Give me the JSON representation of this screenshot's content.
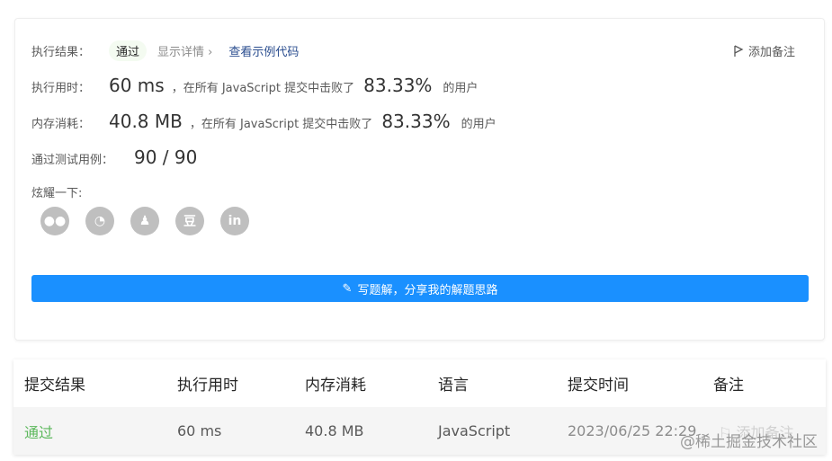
{
  "result": {
    "label": "执行结果：",
    "status": "通过",
    "detail": "显示详情 ›",
    "example": "查看示例代码",
    "add_note": "添加备注"
  },
  "runtime": {
    "label": "执行用时：",
    "value": "60 ms",
    "text": "，在所有 JavaScript 提交中击败了",
    "percent": "83.33%",
    "suffix": "的用户"
  },
  "memory": {
    "label": "内存消耗：",
    "value": "40.8 MB",
    "text": "，在所有 JavaScript 提交中击败了",
    "percent": "83.33%",
    "suffix": "的用户"
  },
  "tests": {
    "label": "通过测试用例：",
    "value": "90 / 90"
  },
  "share": {
    "label": "炫耀一下:",
    "icons": [
      "wechat",
      "weibo",
      "qq",
      "douban",
      "linkedin"
    ]
  },
  "write_button": "写题解，分享我的解题思路",
  "table": {
    "headers": [
      "提交结果",
      "执行用时",
      "内存消耗",
      "语言",
      "提交时间",
      "备注"
    ],
    "row": {
      "status": "通过",
      "runtime": "60 ms",
      "memory": "40.8 MB",
      "language": "JavaScript",
      "time": "2023/06/25 22:29",
      "note": "添加备注"
    }
  },
  "watermark": "@稀土掘金技术社区",
  "colors": {
    "accent": "#1a90ff",
    "pass": "#5cb85c"
  }
}
